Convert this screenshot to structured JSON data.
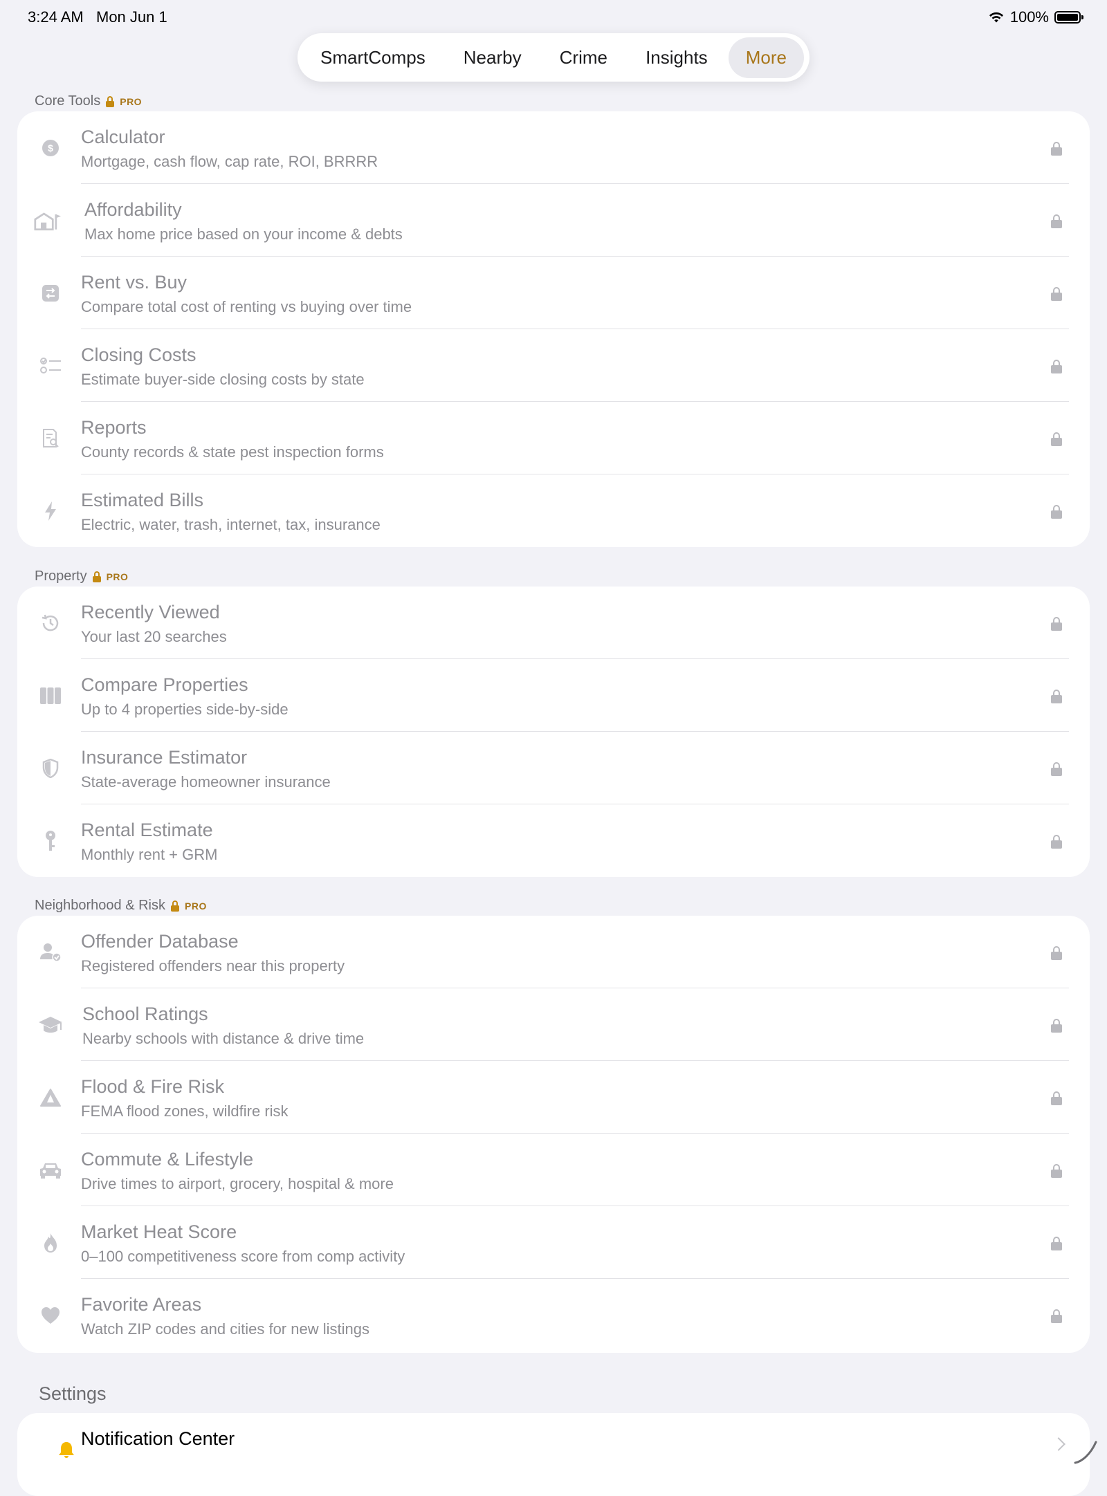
{
  "status_bar": {
    "time": "3:24 AM",
    "date": "Mon Jun 1",
    "battery": "100%"
  },
  "tabs": [
    {
      "label": "SmartComps",
      "active": false
    },
    {
      "label": "Nearby",
      "active": false
    },
    {
      "label": "Crime",
      "active": false
    },
    {
      "label": "Insights",
      "active": false
    },
    {
      "label": "More",
      "active": true
    }
  ],
  "sections": [
    {
      "title": "Core Tools",
      "badge": "PRO",
      "items": [
        {
          "title": "Calculator",
          "subtitle": "Mortgage, cash flow, cap rate, ROI, BRRRR",
          "icon": "dollar-circle-icon",
          "locked": true
        },
        {
          "title": "Affordability",
          "subtitle": "Max home price based on your income & debts",
          "icon": "house-flag-icon",
          "locked": true
        },
        {
          "title": "Rent vs. Buy",
          "subtitle": "Compare total cost of renting vs buying over time",
          "icon": "swap-square-icon",
          "locked": true
        },
        {
          "title": "Closing Costs",
          "subtitle": "Estimate buyer-side closing costs by state",
          "icon": "checklist-icon",
          "locked": true
        },
        {
          "title": "Reports",
          "subtitle": "County records & state pest inspection forms",
          "icon": "document-search-icon",
          "locked": true
        },
        {
          "title": "Estimated Bills",
          "subtitle": "Electric, water, trash, internet, tax, insurance",
          "icon": "bolt-icon",
          "locked": true
        }
      ]
    },
    {
      "title": "Property",
      "badge": "PRO",
      "items": [
        {
          "title": "Recently Viewed",
          "subtitle": "Your last 20 searches",
          "icon": "history-icon",
          "locked": true
        },
        {
          "title": "Compare Properties",
          "subtitle": "Up to 4 properties side-by-side",
          "icon": "columns-icon",
          "locked": true
        },
        {
          "title": "Insurance Estimator",
          "subtitle": "State-average homeowner insurance",
          "icon": "shield-icon",
          "locked": true
        },
        {
          "title": "Rental Estimate",
          "subtitle": "Monthly rent + GRM",
          "icon": "key-icon",
          "locked": true
        }
      ]
    },
    {
      "title": "Neighborhood & Risk",
      "badge": "PRO",
      "items": [
        {
          "title": "Offender Database",
          "subtitle": "Registered offenders near this property",
          "icon": "person-check-icon",
          "locked": true
        },
        {
          "title": "School Ratings",
          "subtitle": "Nearby schools with distance & drive time",
          "icon": "graduation-cap-icon",
          "locked": true
        },
        {
          "title": "Flood & Fire Risk",
          "subtitle": "FEMA flood zones, wildfire risk",
          "icon": "warning-triangle-icon",
          "locked": true
        },
        {
          "title": "Commute & Lifestyle",
          "subtitle": "Drive times to airport, grocery, hospital & more",
          "icon": "car-icon",
          "locked": true
        },
        {
          "title": "Market Heat Score",
          "subtitle": "0–100 competitiveness score from comp activity",
          "icon": "flame-icon",
          "locked": true
        },
        {
          "title": "Favorite Areas",
          "subtitle": "Watch ZIP codes and cities for new listings",
          "icon": "heart-icon",
          "locked": true
        }
      ]
    }
  ],
  "settings": {
    "title": "Settings",
    "items": [
      {
        "title": "Notification Center",
        "icon": "bell-icon"
      }
    ]
  },
  "colors": {
    "accent": "#a8761a",
    "lock_gold": "#c48a12",
    "muted": "#8e8e93",
    "background": "#f2f2f7"
  }
}
